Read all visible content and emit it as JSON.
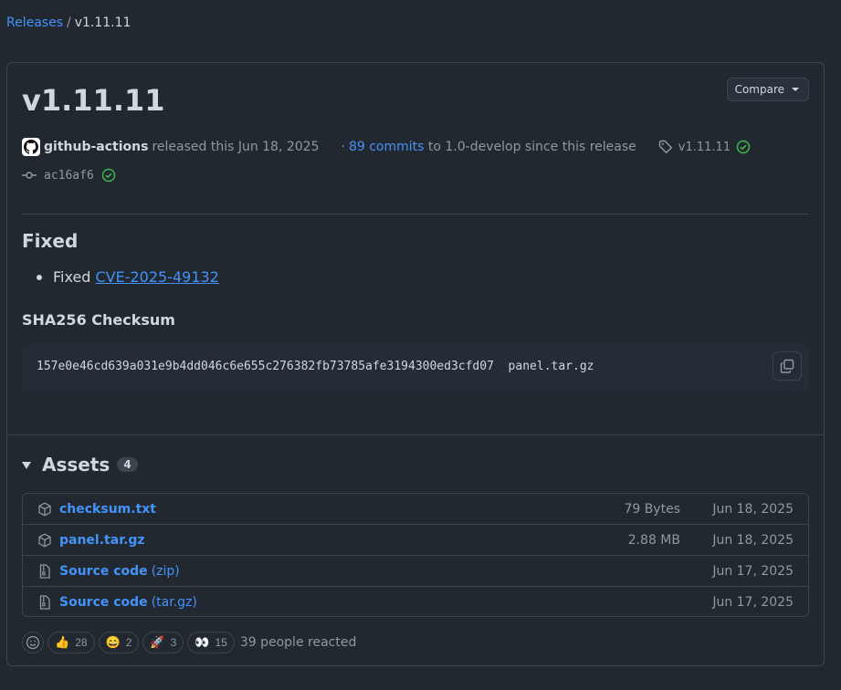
{
  "breadcrumb": {
    "parent": "Releases",
    "separator": "/",
    "current": "v1.11.11"
  },
  "release": {
    "title": "v1.11.11",
    "compare_label": "Compare",
    "author": "github-actions",
    "released_text": "released this Jun 18, 2025",
    "commits_prefix": "·",
    "commits_link": "89 commits",
    "commits_suffix": "to 1.0-develop since this release",
    "tag": "v1.11.11",
    "commit_sha": "ac16af6"
  },
  "notes": {
    "heading": "Fixed",
    "items": [
      {
        "text": "Fixed",
        "link": "CVE-2025-49132"
      }
    ],
    "checksum_heading": "SHA256 Checksum",
    "checksum_code": "157e0e46cd639a031e9b4dd046c6e655c276382fb73785afe3194300ed3cfd07  panel.tar.gz"
  },
  "assets": {
    "heading": "Assets",
    "count": "4",
    "rows": [
      {
        "name": "checksum.txt",
        "suffix": "",
        "size": "79 Bytes",
        "date": "Jun 18, 2025",
        "icon": "package-icon"
      },
      {
        "name": "panel.tar.gz",
        "suffix": "",
        "size": "2.88 MB",
        "date": "Jun 18, 2025",
        "icon": "package-icon"
      },
      {
        "name": "Source code",
        "suffix": "(zip)",
        "size": "",
        "date": "Jun 17, 2025",
        "icon": "file-zip-icon"
      },
      {
        "name": "Source code",
        "suffix": "(tar.gz)",
        "size": "",
        "date": "Jun 17, 2025",
        "icon": "file-zip-icon"
      }
    ]
  },
  "reactions": {
    "items": [
      {
        "emoji": "👍",
        "name": "thumbs-up",
        "count": "28"
      },
      {
        "emoji": "😄",
        "name": "laugh",
        "count": "2"
      },
      {
        "emoji": "🚀",
        "name": "rocket",
        "count": "3"
      },
      {
        "emoji": "👀",
        "name": "eyes",
        "count": "15"
      }
    ],
    "summary": "39 people reacted"
  },
  "colors": {
    "background": "#212830",
    "border": "#3d444d",
    "link": "#4493f8",
    "success": "#3fb950",
    "muted": "#9198a1"
  }
}
